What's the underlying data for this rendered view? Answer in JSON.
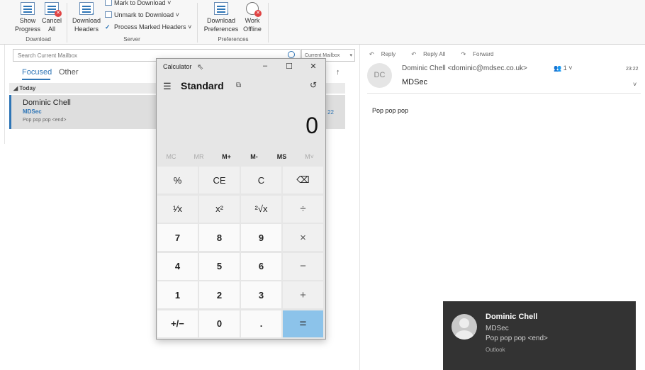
{
  "ribbon": {
    "show_progress": "Show\nProgress",
    "cancel_all": "Cancel\nAll",
    "group_download": "Download",
    "download_headers": "Download\nHeaders",
    "mark_to_download": "Mark to Download",
    "unmark_to_download": "Unmark to Download",
    "process_marked_headers": "Process Marked Headers",
    "group_server": "Server",
    "download_preferences": "Download\nPreferences",
    "work_offline": "Work\nOffline",
    "group_preferences": "Preferences"
  },
  "search": {
    "placeholder": "Search Current Mailbox",
    "scope": "Current Mailbox"
  },
  "tabs": {
    "focused": "Focused",
    "other": "Other"
  },
  "mail_list": {
    "group_today": "Today",
    "items": [
      {
        "sender": "Dominic Chell",
        "subject": "MDSec",
        "preview": "Pop pop pop <end>",
        "time": "22"
      }
    ]
  },
  "reading_pane": {
    "actions": {
      "reply": "Reply",
      "reply_all": "Reply All",
      "forward": "Forward"
    },
    "avatar_initials": "DC",
    "from": "Dominic Chell <dominic@mdsec.co.uk>",
    "people_count": "1",
    "time": "23:22",
    "subject": "MDSec",
    "body": "Pop pop pop"
  },
  "calculator": {
    "title": "Calculator",
    "mode": "Standard",
    "display": "0",
    "memory": [
      "MC",
      "MR",
      "M+",
      "M-",
      "MS",
      "M˅"
    ],
    "keys": [
      [
        "%",
        "CE",
        "C",
        "⌫"
      ],
      [
        "¹⁄x",
        "x²",
        "²√x",
        "÷"
      ],
      [
        "7",
        "8",
        "9",
        "×"
      ],
      [
        "4",
        "5",
        "6",
        "−"
      ],
      [
        "1",
        "2",
        "3",
        "+"
      ],
      [
        "+/−",
        "0",
        ".",
        "="
      ]
    ]
  },
  "toast": {
    "sender": "Dominic Chell",
    "subject": "MDSec",
    "preview": "Pop pop pop <end>",
    "app": "Outlook"
  }
}
